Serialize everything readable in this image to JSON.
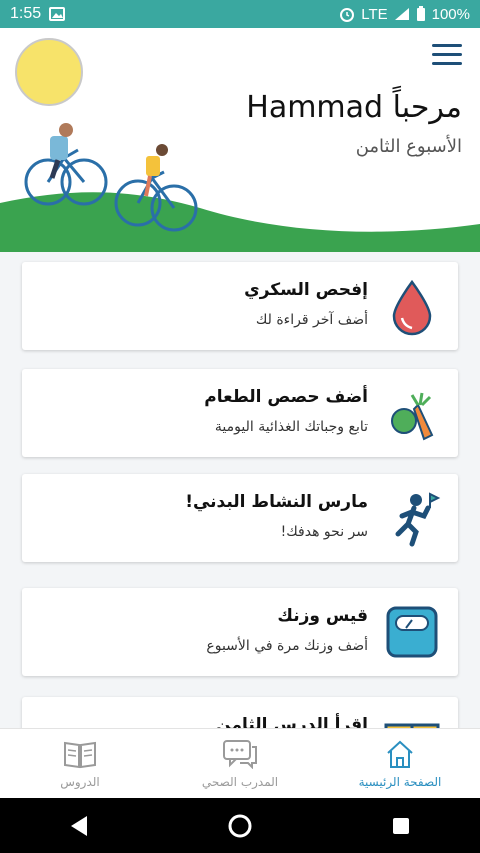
{
  "status": {
    "time": "1:55",
    "network": "LTE",
    "battery": "100%"
  },
  "header": {
    "greeting": "مرحباً Hammad",
    "week": "الأسبوع الثامن"
  },
  "cards": [
    {
      "title": "إفحص السكري",
      "subtitle": "أضف آخر قراءة لك",
      "icon": "blood-drop-icon"
    },
    {
      "title": "أضف حصص الطعام",
      "subtitle": "تابع وجباتك الغذائية اليومية",
      "icon": "vegetables-icon"
    },
    {
      "title": "مارس النشاط البدني!",
      "subtitle": "سر نحو هدفك!",
      "icon": "runner-icon"
    },
    {
      "title": "قيس وزنك",
      "subtitle": "أضف وزنك مرة في الأسبوع",
      "icon": "scale-icon"
    },
    {
      "title": "إقرأ الدرس الثامن",
      "subtitle": "",
      "icon": "book-icon"
    }
  ],
  "bottom_nav": [
    {
      "label": "الصفحة الرئيسية",
      "icon": "home-icon",
      "active": true
    },
    {
      "label": "المدرب الصحي",
      "icon": "chat-icon",
      "active": false
    },
    {
      "label": "الدروس",
      "icon": "book-open-icon",
      "active": false
    }
  ],
  "colors": {
    "status_bar": "#3aa8a0",
    "accent": "#2a8fc0",
    "hill": "#3aa34f",
    "sun": "#f7e36a"
  }
}
